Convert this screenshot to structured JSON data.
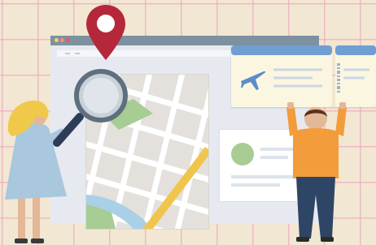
{
  "illustration": {
    "colors": {
      "background": "#f2e7d3",
      "grid_lines": "#eeaabe",
      "browser_titlebar": "#7e91a1",
      "browser_body": "#e6eaf0",
      "map_land": "#f4f1ec",
      "map_park": "#a7cc94",
      "map_water": "#a9d0e6",
      "map_road": "#f1c54d",
      "location_pin": "#b5283b",
      "ticket_header": "#6f9fd2",
      "ticket_body": "#fbf6e0",
      "airplane": "#5b8ec8",
      "card_avatar": "#a7cc94",
      "woman_hair": "#f1c94a",
      "woman_dress": "#a9c7dd",
      "man_shirt": "#f29c3c",
      "man_pants": "#2f4566"
    },
    "icons": [
      "location-pin-icon",
      "magnifying-glass-icon",
      "airplane-icon",
      "window-dots-icon",
      "barcode-icon"
    ],
    "elements": [
      "browser-window",
      "city-map",
      "plane-ticket",
      "profile-card",
      "woman-with-magnifier",
      "man-holding-ticket"
    ]
  }
}
